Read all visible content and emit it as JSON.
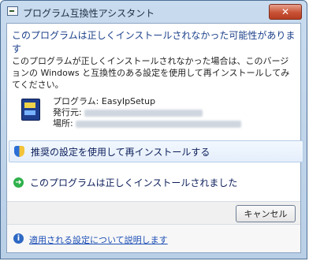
{
  "window": {
    "title": "プログラム互換性アシスタント",
    "close_label": "✕"
  },
  "headline": "このプログラムは正しくインストールされなかった可能性があります",
  "description": "このプログラムが正しくインストールされなかった場合は、このバージョンの Windows と互換性のある設定を使用して再インストールしてみてください。",
  "program": {
    "name_label": "プログラム:",
    "name_value": "EasyIpSetup",
    "publisher_label": "発行元:",
    "location_label": "場所:"
  },
  "options": [
    {
      "label": "推奨の設定を使用して再インストールする",
      "icon": "shield-icon"
    },
    {
      "label": "このプログラムは正しくインストールされました",
      "icon": "green-arrow-icon"
    }
  ],
  "buttons": {
    "cancel": "キャンセル"
  },
  "footer": {
    "help_link": "適用される設定について説明します"
  },
  "colors": {
    "headline": "#1a3f8a",
    "link": "#1d4fb6",
    "close_button": "#c85236"
  }
}
